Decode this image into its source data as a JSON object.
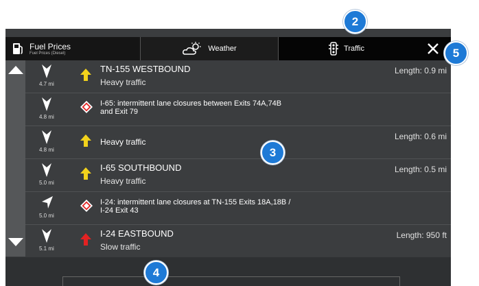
{
  "tabs": {
    "fuel": {
      "title": "Fuel Prices",
      "subtitle": "Fuel Prices (Diesel)"
    },
    "weather": {
      "label": "Weather"
    },
    "traffic": {
      "label": "Traffic"
    }
  },
  "rows": [
    {
      "distance": "4.7 mi",
      "title": "TN-155  WESTBOUND",
      "desc": "Heavy traffic",
      "length": "Length: 0.9 mi"
    },
    {
      "distance": "4.8 mi",
      "text": "I-65: intermittent lane closures between Exits 74A,74B\nand Exit 79"
    },
    {
      "distance": "4.8 mi",
      "text": "Heavy traffic",
      "length": "Length: 0.6 mi"
    },
    {
      "distance": "5.0 mi",
      "title": "I-65  SOUTHBOUND",
      "desc": "Heavy traffic",
      "length": "Length: 0.5 mi"
    },
    {
      "distance": "5.0 mi",
      "text": "I-24: intermittent lane closures at TN-155 Exits 18A,18B /\nI-24 Exit 43"
    },
    {
      "distance": "5.1 mi",
      "title": "I-24  EASTBOUND",
      "desc": "Slow traffic",
      "length": "Length: 950 ft"
    }
  ],
  "callouts": {
    "c2": "2",
    "c3": "3",
    "c4": "4",
    "c5": "5"
  },
  "colors": {
    "accent": "#1e7ad6",
    "heavy": "#f2d21c",
    "slow": "#e32222"
  },
  "icons": {
    "fuel": "fuel-pump-icon",
    "weather": "cloud-sun-icon",
    "traffic": "traffic-light-icon",
    "close": "close-icon"
  }
}
